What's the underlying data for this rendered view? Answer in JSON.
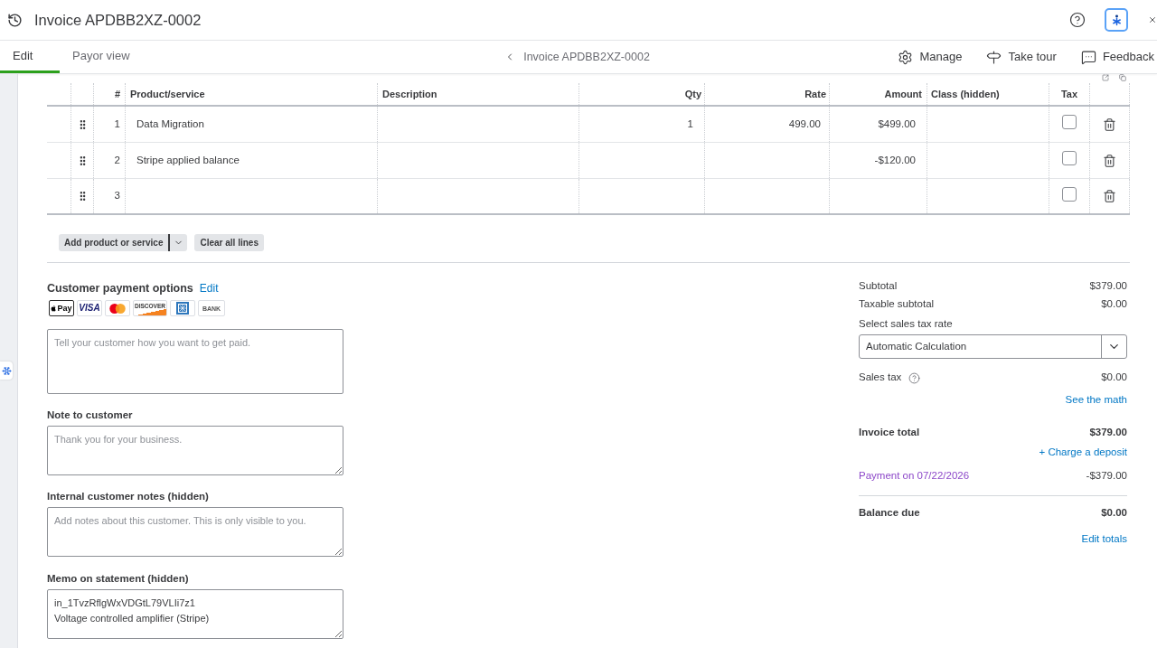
{
  "header": {
    "title": "Invoice APDBB2XZ-0002"
  },
  "tabs": [
    {
      "label": "Edit",
      "selected": true
    },
    {
      "label": "Payor view",
      "selected": false
    }
  ],
  "breadcrumb": {
    "label": "Invoice APDBB2XZ-0002"
  },
  "toolbar": [
    {
      "label": "Manage"
    },
    {
      "label": "Take tour"
    },
    {
      "label": "Feedback"
    }
  ],
  "table": {
    "columns": [
      "#",
      "Product/service",
      "Description",
      "Qty",
      "Rate",
      "Amount",
      "Class (hidden)",
      "Tax"
    ],
    "rows": [
      {
        "number": "1",
        "product": "Data Migration",
        "qty": "1",
        "rate": "499.00",
        "amount": "$499.00",
        "tax_checked": false
      },
      {
        "number": "2",
        "product": "Stripe applied balance",
        "amount": "-$120.00",
        "tax_checked": false
      },
      {
        "number": "3",
        "tax_checked": false
      }
    ]
  },
  "line_actions": {
    "add": "Add product or service",
    "clear": "Clear all lines"
  },
  "payment_options": {
    "title": "Customer payment options",
    "edit": "Edit",
    "methods": [
      {
        "kind": "wallet",
        "text": "Pay"
      },
      {
        "kind": "wordmark",
        "text": "VISA"
      },
      {
        "kind": "circles"
      },
      {
        "kind": "stripe",
        "text": "DISCOVER"
      },
      {
        "kind": "tile"
      },
      {
        "kind": "plain",
        "text": "BANK"
      }
    ],
    "message_field": {
      "placeholder": "Tell your customer how you want to get paid."
    }
  },
  "notes": [
    {
      "label": "Note to customer",
      "placeholder": "Thank you for your business."
    },
    {
      "label": "Internal customer notes (hidden)",
      "placeholder": "Add notes about this customer. This is only visible to you."
    },
    {
      "label": "Memo on statement (hidden)",
      "value": "in_1TvzRflgWxVDGtL79VLIi7z1\nVoltage controlled amplifier (Stripe)"
    }
  ],
  "totals": {
    "subtotal": {
      "label": "Subtotal",
      "value": "$379.00"
    },
    "taxable_subtotal": {
      "label": "Taxable subtotal",
      "value": "$0.00"
    },
    "tax_rate": {
      "label": "Select sales tax rate",
      "value": "Automatic Calculation"
    },
    "sales_tax": {
      "label": "Sales tax",
      "value": "$0.00"
    },
    "see_math": "See the math",
    "invoice_total": {
      "label": "Invoice total",
      "value": "$379.00"
    },
    "charge_deposit": "+ Charge a deposit",
    "payments": [
      {
        "label": "Payment on 07/22/2026",
        "value": "-$379.00"
      }
    ],
    "balance_due": {
      "label": "Balance due",
      "value": "$0.00"
    },
    "edit_totals": "Edit totals"
  }
}
